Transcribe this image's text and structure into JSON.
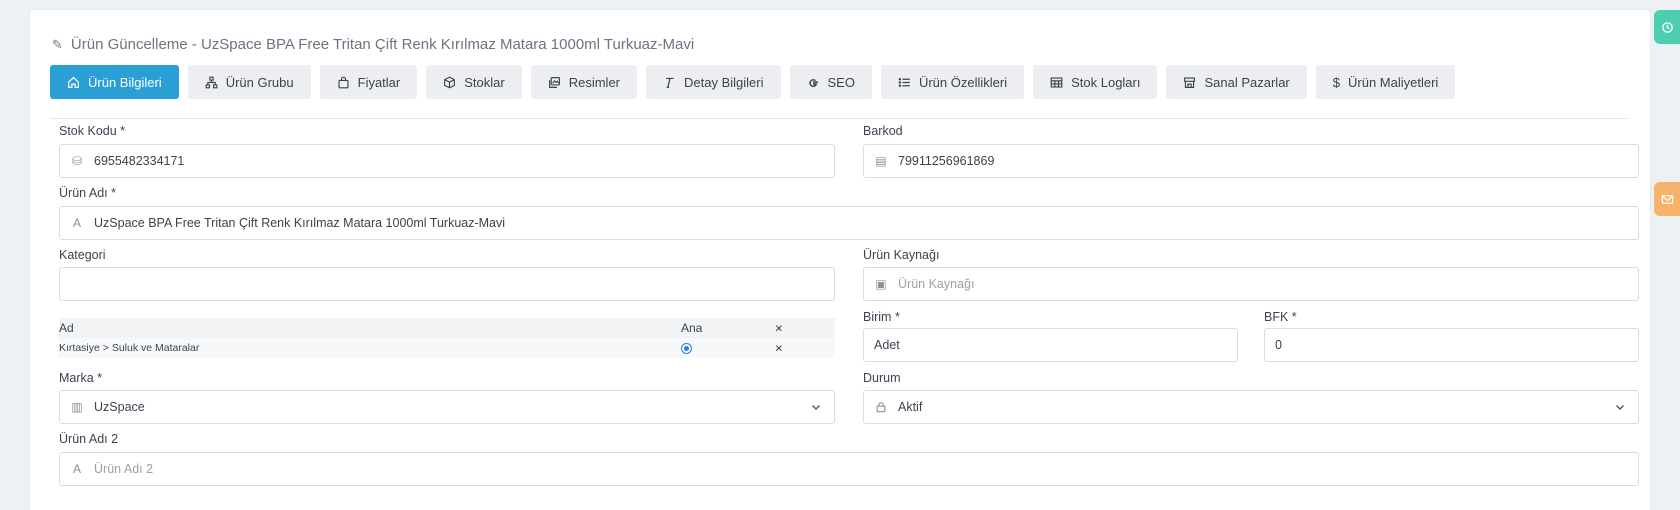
{
  "page": {
    "title": "Ürün Güncelleme - UzSpace BPA Free Tritan Çift Renk Kırılmaz Matara 1000ml Turkuaz-Mavi"
  },
  "tabs": [
    {
      "label": "Ürün Bilgileri",
      "icon": "home-icon",
      "active": true
    },
    {
      "label": "Ürün Grubu",
      "icon": "sitemap-icon"
    },
    {
      "label": "Fiyatlar",
      "icon": "shopping-bag-icon"
    },
    {
      "label": "Stoklar",
      "icon": "box-icon"
    },
    {
      "label": "Resimler",
      "icon": "images-icon"
    },
    {
      "label": "Detay Bilgileri",
      "icon": "text-icon"
    },
    {
      "label": "SEO",
      "icon": "google-icon"
    },
    {
      "label": "Ürün Özellikleri",
      "icon": "list-icon"
    },
    {
      "label": "Stok Logları",
      "icon": "table-icon"
    },
    {
      "label": "Sanal Pazarlar",
      "icon": "store-icon"
    },
    {
      "label": "Ürün Maliyetleri",
      "icon": "dollar-icon"
    }
  ],
  "form": {
    "stok_kodu": {
      "label": "Stok Kodu *",
      "value": "6955482334171"
    },
    "barkod": {
      "label": "Barkod",
      "value": "79911256961869"
    },
    "urun_adi": {
      "label": "Ürün Adı *",
      "value": "UzSpace BPA Free Tritan Çift Renk Kırılmaz Matara 1000ml Turkuaz-Mavi"
    },
    "kategori": {
      "label": "Kategori",
      "value": ""
    },
    "urun_kaynagi": {
      "label": "Ürün Kaynağı",
      "placeholder": "Ürün Kaynağı"
    },
    "birim": {
      "label": "Birim *",
      "value": "Adet"
    },
    "bfk": {
      "label": "BFK *",
      "value": "0"
    },
    "marka": {
      "label": "Marka *",
      "value": "UzSpace"
    },
    "durum": {
      "label": "Durum",
      "value": "Aktif"
    },
    "urun_adi_2": {
      "label": "Ürün Adı 2",
      "placeholder": "Ürün Adı 2"
    }
  },
  "category_table": {
    "headers": {
      "ad": "Ad",
      "ana": "Ana",
      "remove": "×"
    },
    "rows": [
      {
        "ad": "Kırtasiye > Suluk ve Mataralar",
        "ana": true,
        "remove": "×"
      }
    ]
  },
  "colors": {
    "accent": "#2a9fd6",
    "side_green": "#4ccfb0",
    "side_orange": "#f7b36a"
  }
}
